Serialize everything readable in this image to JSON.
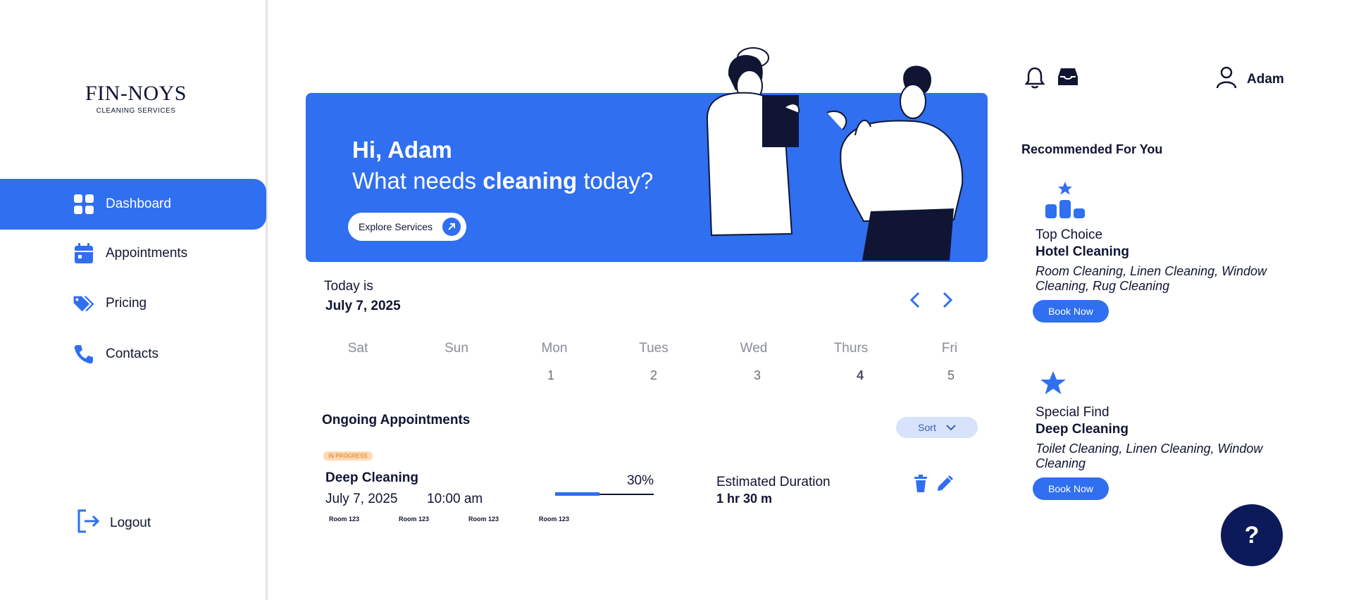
{
  "brand": {
    "name": "FIN-NOYS",
    "tagline": "CLEANING SERVICES"
  },
  "sidebar": {
    "items": [
      {
        "label": "Dashboard",
        "icon": "dashboard-grid-icon",
        "active": true
      },
      {
        "label": "Appointments",
        "icon": "calendar-icon",
        "active": false
      },
      {
        "label": "Pricing",
        "icon": "price-tag-icon",
        "active": false
      },
      {
        "label": "Contacts",
        "icon": "phone-icon",
        "active": false
      }
    ],
    "logout_label": "Logout"
  },
  "hero": {
    "greeting": "Hi, Adam",
    "question_prefix": "What needs ",
    "question_bold": "cleaning",
    "question_suffix": " today?",
    "cta_label": "Explore Services"
  },
  "date": {
    "label": "Today is",
    "value": "July 7, 2025",
    "days": [
      {
        "name": "Sat",
        "num": ""
      },
      {
        "name": "Sun",
        "num": ""
      },
      {
        "name": "Mon",
        "num": "1"
      },
      {
        "name": "Tues",
        "num": "2"
      },
      {
        "name": "Wed",
        "num": "3"
      },
      {
        "name": "Thurs",
        "num": "4"
      },
      {
        "name": "Fri",
        "num": "5"
      }
    ]
  },
  "appointments": {
    "title": "Ongoing Appointments",
    "sort_label": "Sort",
    "items": [
      {
        "status": "IN PROGRESS",
        "service": "Deep Cleaning",
        "date": "July 7, 2025",
        "time": "10:00 am",
        "rooms": [
          "Room 123",
          "Room 123",
          "Room 123",
          "Room 123"
        ],
        "progress": 30,
        "progress_label": "30%",
        "duration_label": "Estimated Duration",
        "duration": "1 hr 30 m"
      }
    ]
  },
  "header": {
    "user_name": "Adam"
  },
  "recommended": {
    "title": "Recommended For You",
    "items": [
      {
        "kicker": "Top Choice",
        "name": "Hotel Cleaning",
        "desc": "Room Cleaning, Linen Cleaning, Window Cleaning, Rug Cleaning",
        "cta": "Book Now",
        "icon": "ranking-podium-icon"
      },
      {
        "kicker": "Special Find",
        "name": "Deep Cleaning",
        "desc": "Toilet Cleaning, Linen Cleaning, Window Cleaning",
        "cta": "Book Now",
        "icon": "star-icon"
      }
    ]
  },
  "help_label": "?",
  "colors": {
    "primary": "#2f6ff0",
    "dark": "#0f1533",
    "help_bg": "#0d1a5a",
    "badge_bg": "#ffd9b0"
  }
}
